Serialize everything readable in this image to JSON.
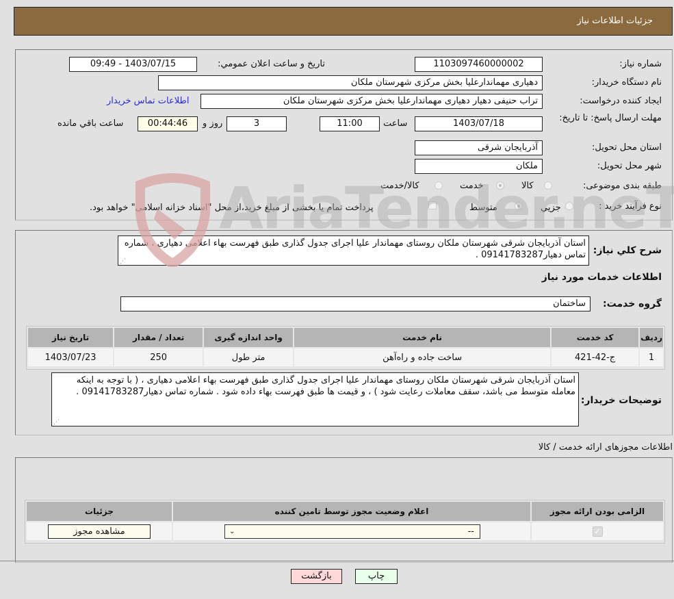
{
  "header": {
    "title": "جزئیات اطلاعات نیاز"
  },
  "form": {
    "need_number": {
      "label": "شماره نیاز:",
      "value": "1103097460000002"
    },
    "announce_datetime": {
      "label": "تاریخ و ساعت اعلان عمومي:",
      "value": "1403/07/15 - 09:49"
    },
    "buyer_org": {
      "label": "نام دستگاه خريدار:",
      "value": "دهیاری مهماندارعلیا بخش مرکزی شهرستان ملکان"
    },
    "requester": {
      "label": "ایجاد کننده درخواست:",
      "value": "تراب حنیفی دهیار دهیاری مهماندارعلیا بخش مرکزی شهرستان ملکان"
    },
    "buyer_contact_link": "اطلاعات تماس خریدار",
    "deadline": {
      "label": "مهلت ارسال پاسخ: تا تاریخ:",
      "date": "1403/07/18",
      "time_label": "ساعت",
      "time": "11:00",
      "days": "3",
      "days_label": "روز و",
      "remaining": "00:44:46",
      "remaining_label": "ساعت باقي مانده"
    },
    "province": {
      "label": "استان محل تحویل:",
      "value": "آذربایجان شرقی"
    },
    "city": {
      "label": "شهر محل تحویل:",
      "value": "ملکان"
    },
    "category": {
      "label": "طبقه بندی موضوعی:",
      "options": [
        "کالا",
        "خدمت",
        "کالا/خدمت"
      ],
      "selected": "خدمت"
    },
    "purchase_type": {
      "label": "نوع فرآیند خرید :",
      "options": [
        "جزيي",
        "متوسط"
      ],
      "selected": "متوسط",
      "treasury_checkbox_label": "پرداخت تمام یا بخشی از مبلغ خرید،از محل \"اسناد خزانه اسلامی\" خواهد بود."
    }
  },
  "description": {
    "label": "شرح کلي نياز:",
    "value": "استان آذربایجان شرقی شهرستان ملکان روستای مهماندار علیا اجرای جدول گذاری طبق فهرست بهاء اعلامی دهیاری ، شماره تماس دهیار09141783287 ."
  },
  "services": {
    "section_title": "اطلاعات خدمات مورد نیاز",
    "group_label": "گروه خدمت:",
    "group_value": "ساختمان",
    "columns": [
      "ردیف",
      "کد خدمت",
      "نام خدمت",
      "واحد اندازه گیری",
      "تعداد / مقدار",
      "تاریخ نیاز"
    ],
    "rows": [
      [
        "1",
        "ج-42-421",
        "ساخت جاده و راه‌آهن",
        "متر طول",
        "250",
        "1403/07/23"
      ]
    ]
  },
  "buyer_notes": {
    "label": "توضیحات خریدار:",
    "value": "استان آذربایجان شرقی شهرستان ملکان روستای مهماندار علیا اجرای جدول گذاری طبق فهرست بهاء اعلامی دهیاری ، ( با توجه به اینکه معامله متوسط می باشد، سقف معاملات رعایت شود ) ، و قیمت ها طبق فهرست بهاء داده شود . شماره تماس دهیار09141783287 ."
  },
  "permits": {
    "section_title": "اطلاعات مجوزهای ارائه خدمت / کالا",
    "columns": [
      "الزامی بودن ارائه مجوز",
      "اعلام وضعیت مجوز توسط تامین کننده",
      "جزئیات"
    ],
    "row": {
      "required_checked": true,
      "status_select": "--",
      "details_button": "مشاهده مجوز"
    }
  },
  "buttons": {
    "print": "چاپ",
    "back": "بازگشت"
  },
  "watermark": "AriaTender.neT"
}
